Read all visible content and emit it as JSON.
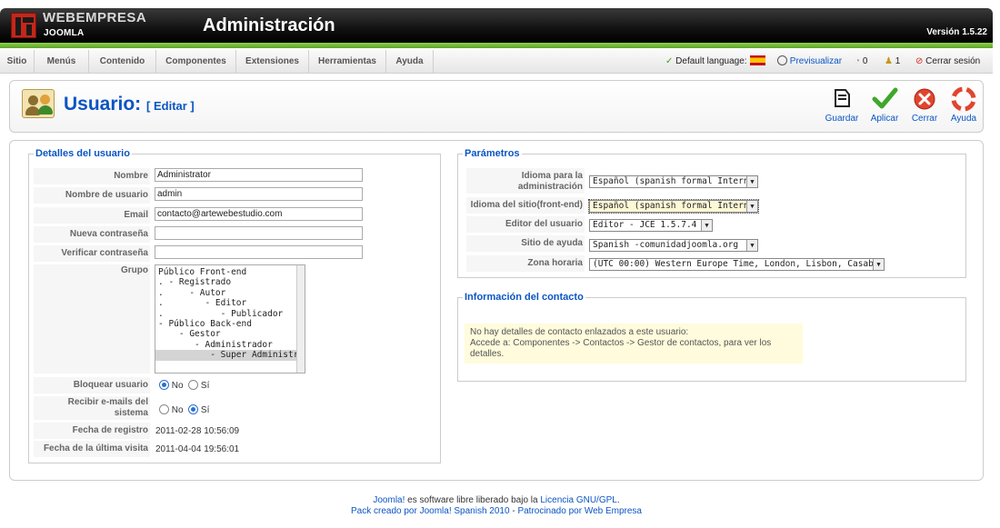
{
  "header": {
    "brand": "WEBEMPRESA",
    "brand_sub": "JOOMLA",
    "title": "Administración",
    "version": "Versión 1.5.22"
  },
  "menu": {
    "items": [
      "Sitio",
      "Menús",
      "Contenido",
      "Componentes",
      "Extensiones",
      "Herramientas",
      "Ayuda"
    ],
    "default_language": "Default language:",
    "preview": "Previsualizar",
    "messages_count": "0",
    "users_count": "1",
    "logout": "Cerrar sesión"
  },
  "toolbar": {
    "title": "Usuario:",
    "subtitle": "[ Editar ]",
    "buttons": {
      "save": "Guardar",
      "apply": "Aplicar",
      "close": "Cerrar",
      "help": "Ayuda"
    }
  },
  "user_details": {
    "legend": "Detalles del usuario",
    "labels": {
      "name": "Nombre",
      "username": "Nombre de usuario",
      "email": "Email",
      "new_password": "Nueva contraseña",
      "verify_password": "Verificar contraseña",
      "group": "Grupo",
      "block_user": "Bloquear usuario",
      "receive_emails": "Recibir e-mails del sistema",
      "register_date": "Fecha de registro",
      "last_visit": "Fecha de la última visita"
    },
    "values": {
      "name": "Administrator",
      "username": "admin",
      "email": "contacto@artewebestudio.com",
      "new_password": "",
      "verify_password": "",
      "register_date": "2011-02-28 10:56:09",
      "last_visit": "2011-04-04 19:56:01"
    },
    "groups": [
      "Público Front-end",
      ". - Registrado",
      ".     - Autor",
      ".        - Editor",
      ".           - Publicador",
      "- Público Back-end",
      "    - Gestor",
      "       - Administrador",
      "          - Super Administrador"
    ],
    "selected_group_index": 8,
    "radio_no": "No",
    "radio_yes": "Sí",
    "block_user_value": "No",
    "receive_emails_value": "Sí"
  },
  "parameters": {
    "legend": "Parámetros",
    "labels": {
      "admin_language": "Idioma para la administración",
      "site_language": "Idioma del sitio(front-end)",
      "editor": "Editor del usuario",
      "help_site": "Sitio de ayuda",
      "timezone": "Zona horaria"
    },
    "values": {
      "admin_language": "Español (spanish formal Internacional)",
      "site_language": "Español (spanish formal Internacional)",
      "editor": "Editor - JCE 1.5.7.4",
      "help_site": "Spanish -comunidadjoomla.org",
      "timezone": "(UTC 00:00) Western Europe Time, London, Lisbon, Casablanca"
    }
  },
  "contact_info": {
    "legend": "Información del contacto",
    "line1": "No hay detalles de contacto enlazados a este usuario:",
    "line2": "Accede a: Componentes -> Contactos -> Gestor de contactos, para ver los detalles."
  },
  "footer": {
    "joomla": "Joomla!",
    "text1": " es software libre liberado bajo la ",
    "license": "Licencia GNU/GPL",
    "dot": ".",
    "pack": "Pack creado por Joomla! Spanish 2010",
    "sep": " - ",
    "sponsor": "Patrocinado por Web Empresa"
  },
  "colors": {
    "link": "#0b55c4",
    "header_green": "#6cb33a",
    "logo_red": "#c4271b"
  }
}
